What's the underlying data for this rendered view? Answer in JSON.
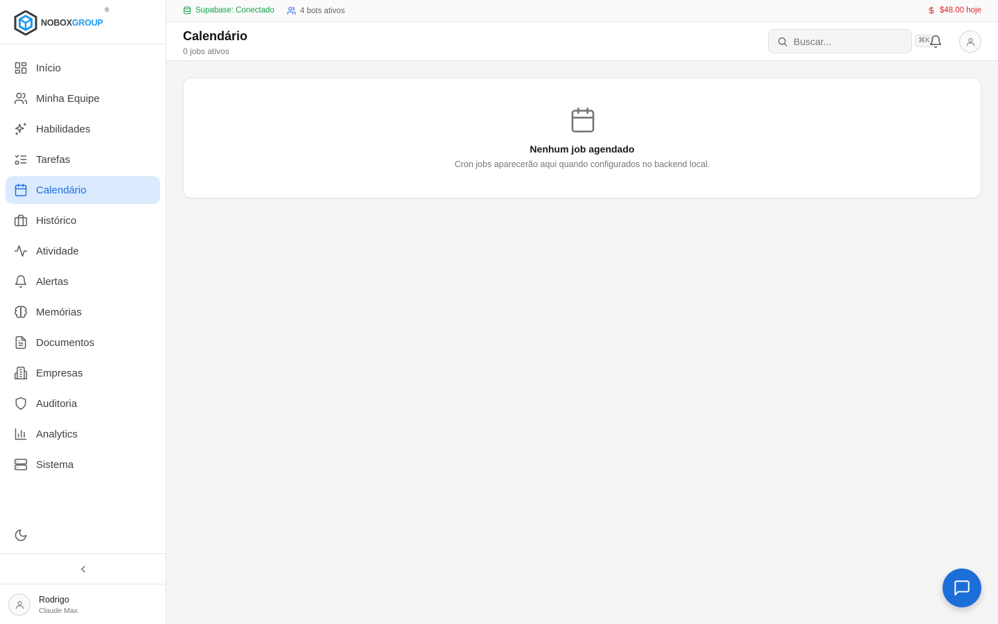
{
  "brand": {
    "part1": "NOBOX",
    "part2": "GROUP",
    "reg": "®"
  },
  "sidebar": {
    "items": [
      {
        "label": "Início",
        "icon": "grid-icon"
      },
      {
        "label": "Minha Equipe",
        "icon": "users-icon"
      },
      {
        "label": "Habilidades",
        "icon": "sparkles-icon"
      },
      {
        "label": "Tarefas",
        "icon": "list-checks-icon"
      },
      {
        "label": "Calendário",
        "icon": "calendar-icon",
        "active": true
      },
      {
        "label": "Histórico",
        "icon": "briefcase-icon"
      },
      {
        "label": "Atividade",
        "icon": "activity-icon"
      },
      {
        "label": "Alertas",
        "icon": "bell-icon"
      },
      {
        "label": "Memórias",
        "icon": "brain-icon"
      },
      {
        "label": "Documentos",
        "icon": "file-text-icon"
      },
      {
        "label": "Empresas",
        "icon": "building-icon"
      },
      {
        "label": "Auditoria",
        "icon": "shield-icon"
      },
      {
        "label": "Analytics",
        "icon": "bar-chart-icon"
      },
      {
        "label": "Sistema",
        "icon": "server-icon"
      }
    ]
  },
  "user": {
    "name": "Rodrigo",
    "plan": "Claude Max"
  },
  "status": {
    "supabase": "Supabase: Conectado",
    "bots": "4 bots ativos",
    "cost": "$48.00 hoje"
  },
  "header": {
    "title": "Calendário",
    "subtitle": "0 jobs ativos",
    "search_placeholder": "Buscar...",
    "shortcut": "⌘K"
  },
  "empty_state": {
    "title": "Nenhum job agendado",
    "description": "Cron jobs aparecerão aqui quando configurados no backend local."
  },
  "colors": {
    "accent": "#1d6fd8",
    "active_bg": "#dbeafe",
    "success": "#16a34a",
    "danger": "#dc2626"
  }
}
